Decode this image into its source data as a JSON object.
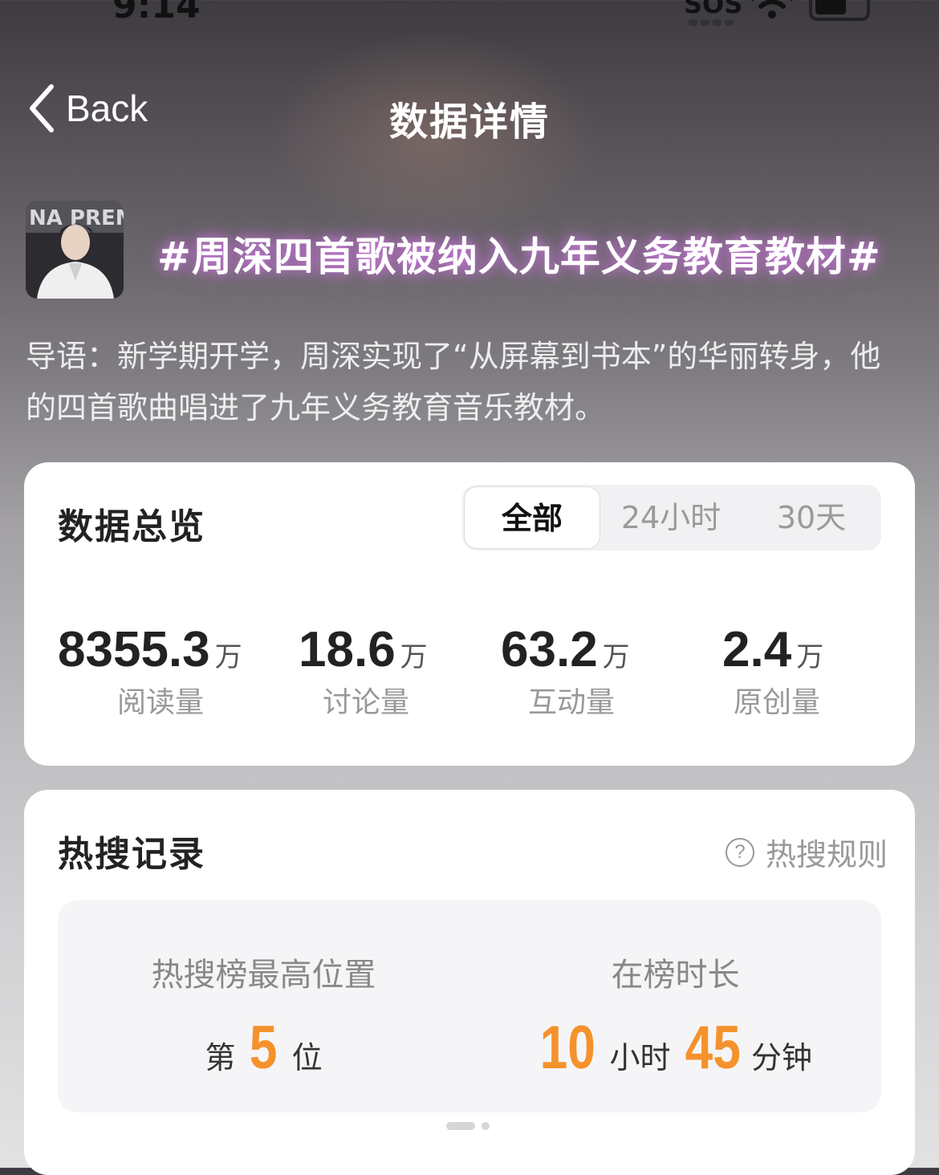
{
  "status_bar": {
    "time": "9:14",
    "sos": "SOS"
  },
  "nav": {
    "back_label": "Back",
    "title": "数据详情"
  },
  "topic": {
    "title": "#周深四首歌被纳入九年义务教育教材#",
    "intro": "导语：新学期开学，周深实现了“从屏幕到书本”的华丽转身，他的四首歌曲唱进了九年义务教育音乐教材。"
  },
  "overview": {
    "title": "数据总览",
    "tabs": [
      "全部",
      "24小时",
      "30天"
    ],
    "selected_tab": "全部",
    "stats": [
      {
        "value": "8355.3",
        "unit": "万",
        "label": "阅读量"
      },
      {
        "value": "18.6",
        "unit": "万",
        "label": "讨论量"
      },
      {
        "value": "63.2",
        "unit": "万",
        "label": "互动量"
      },
      {
        "value": "2.4",
        "unit": "万",
        "label": "原创量"
      }
    ]
  },
  "hot_search": {
    "title": "热搜记录",
    "rules_label": "热搜规则",
    "rules_icon": "question-circle-icon",
    "highest_label": "热搜榜最高位置",
    "highest_prefix": "第",
    "highest_value": "5",
    "highest_suffix": "位",
    "duration_label": "在榜时长",
    "duration_hours": "10",
    "duration_hours_unit": "小时",
    "duration_minutes": "45",
    "duration_minutes_unit": "分钟"
  },
  "colors": {
    "accent_orange": "#f5922c",
    "title_glow": "#d27ae6"
  }
}
